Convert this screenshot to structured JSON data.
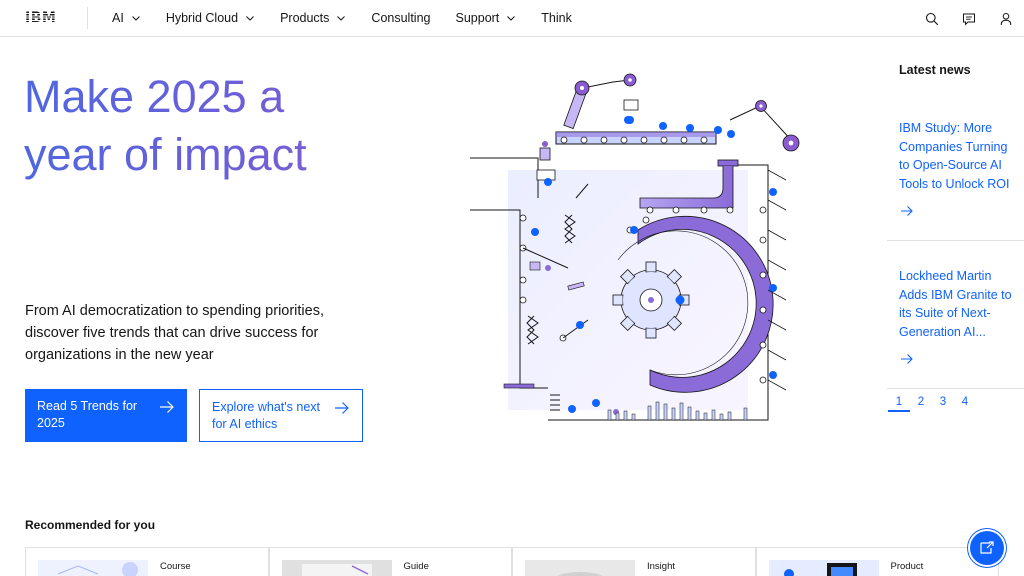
{
  "header": {
    "logo": "IBM",
    "nav": [
      {
        "label": "AI",
        "has_menu": true
      },
      {
        "label": "Hybrid Cloud",
        "has_menu": true
      },
      {
        "label": "Products",
        "has_menu": true
      },
      {
        "label": "Consulting",
        "has_menu": false
      },
      {
        "label": "Support",
        "has_menu": true
      },
      {
        "label": "Think",
        "has_menu": false
      }
    ],
    "icons": [
      "search-icon",
      "chat-icon",
      "user-icon"
    ]
  },
  "hero": {
    "title_line1": "Make 2025 a",
    "title_line2": "year of impact",
    "description": "From AI democratization to spending priorities, discover five trends that can drive success for organizations in the new year",
    "primary_cta": "Read 5 Trends for 2025",
    "secondary_cta": "Explore what's next for AI ethics"
  },
  "latest_news": {
    "heading": "Latest news",
    "items": [
      {
        "title": "IBM Study: More Companies Turning to Open-Source AI Tools to Unlock ROI"
      },
      {
        "title": "Lockheed Martin Adds IBM Granite to its Suite of Next-Generation AI..."
      }
    ],
    "pages": [
      "1",
      "2",
      "3",
      "4"
    ],
    "current_page": "1"
  },
  "recommended": {
    "heading": "Recommended for you",
    "cards": [
      {
        "type": "Course"
      },
      {
        "type": "Guide"
      },
      {
        "type": "Insight"
      },
      {
        "type": "Product"
      }
    ]
  },
  "colors": {
    "accent": "#0f62fe",
    "title_gradient_start": "#5066e0",
    "title_gradient_end": "#8a5cd0",
    "illustration_purple": "#8a6bd8",
    "illustration_blue": "#0f62fe",
    "border": "#e0e0e0"
  }
}
